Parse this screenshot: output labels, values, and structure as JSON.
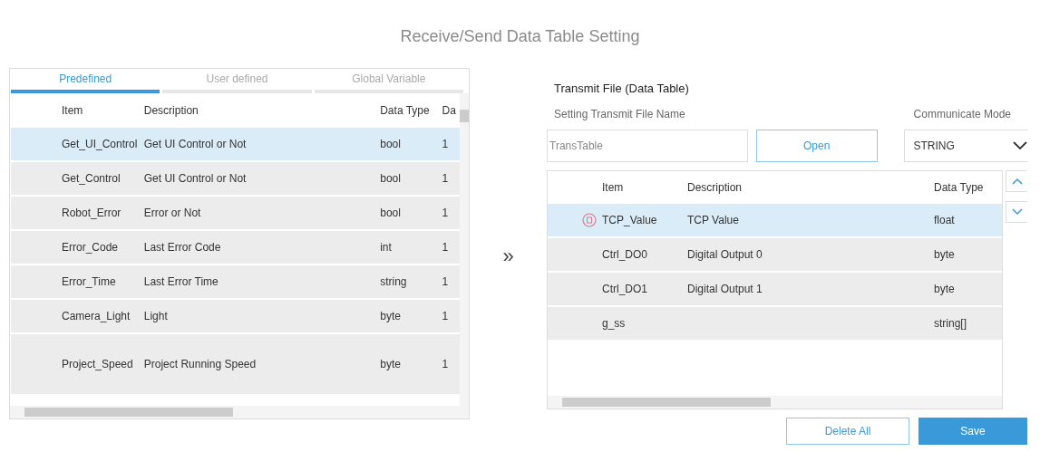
{
  "title": "Receive/Send Data Table Setting",
  "tabs": [
    {
      "label": "Predefined",
      "selected": true
    },
    {
      "label": "User defined",
      "selected": false
    },
    {
      "label": "Global Variable",
      "selected": false
    }
  ],
  "left_table": {
    "columns": [
      "Item",
      "Description",
      "Data Type",
      "Da"
    ],
    "rows": [
      {
        "cells": [
          "Get_UI_Control",
          "Get UI Control or Not",
          "bool",
          "1"
        ],
        "selected": true
      },
      {
        "cells": [
          "Get_Control",
          "Get UI Control or Not",
          "bool",
          "1"
        ],
        "selected": false
      },
      {
        "cells": [
          "Robot_Error",
          "Error or Not",
          "bool",
          "1"
        ],
        "selected": false
      },
      {
        "cells": [
          "Error_Code",
          "Last Error Code",
          "int",
          "1"
        ],
        "selected": false
      },
      {
        "cells": [
          "Error_Time",
          "Last Error Time",
          "string",
          "1"
        ],
        "selected": false
      },
      {
        "cells": [
          "Camera_Light",
          "Light",
          "byte",
          "1"
        ],
        "selected": false
      },
      {
        "cells": [
          "Project_Speed",
          "Project Running Speed",
          "byte",
          "1"
        ],
        "selected": false
      }
    ]
  },
  "transfer_button": "»",
  "right": {
    "heading": "Transmit File (Data Table)",
    "file_label": "Setting Transmit File Name",
    "file_name": "TransTable",
    "open_button": "Open",
    "mode_label": "Communicate Mode",
    "mode": "STRING",
    "table": {
      "columns": [
        "Item",
        "Description",
        "Data Type"
      ],
      "rows": [
        {
          "cells": [
            "TCP_Value",
            "TCP Value",
            "float"
          ],
          "selected": true
        },
        {
          "cells": [
            "Ctrl_DO0",
            "Digital Output 0",
            "byte"
          ],
          "selected": false
        },
        {
          "cells": [
            "Ctrl_DO1",
            "Digital Output 1",
            "byte"
          ],
          "selected": false
        },
        {
          "cells": [
            "g_ss",
            "",
            "string[]"
          ],
          "selected": false
        }
      ]
    },
    "buttons": [
      "Delete All",
      "Save"
    ]
  }
}
